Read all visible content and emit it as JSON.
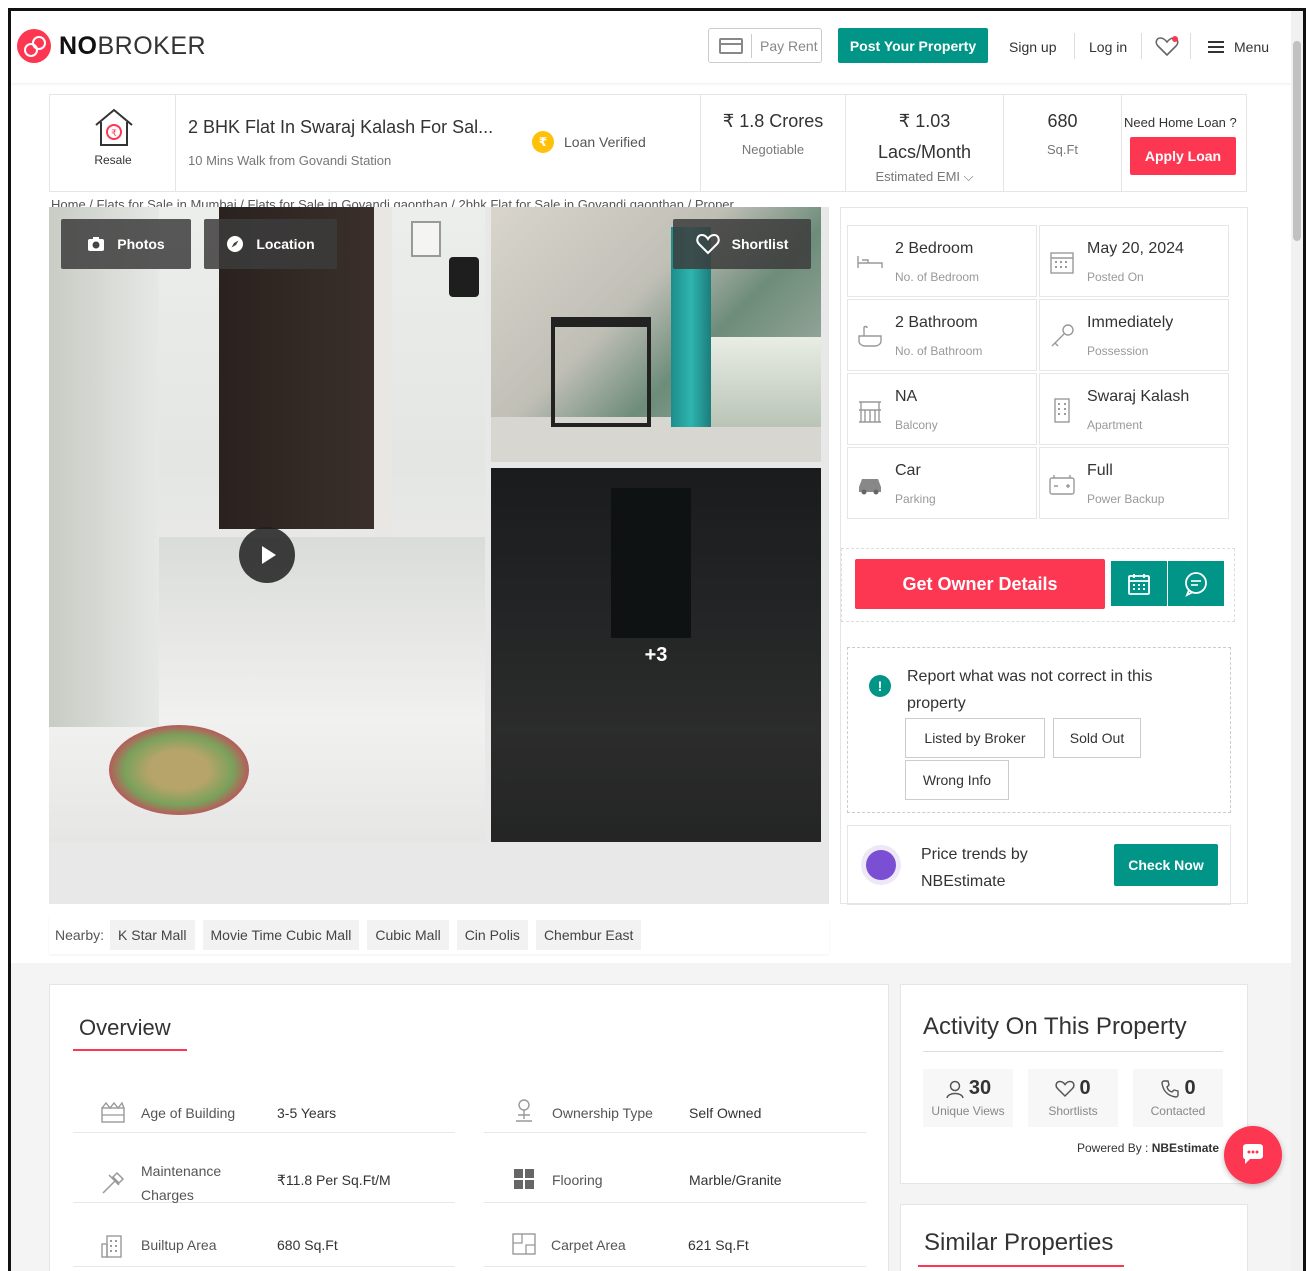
{
  "header": {
    "logo_text_bold": "NO",
    "logo_text_rest": "BROKER",
    "pay_rent": "Pay Rent",
    "post_property": "Post Your Property",
    "sign_up": "Sign up",
    "log_in": "Log in",
    "menu": "Menu"
  },
  "summary": {
    "resale": "Resale",
    "title": "2 BHK Flat In Swaraj Kalash For Sal...",
    "subtitle": "10 Mins Walk from Govandi Station",
    "loan_verified": "Loan Verified",
    "price": "₹ 1.8 Crores",
    "price_note": "Negotiable",
    "emi_line1": "₹ 1.03",
    "emi_line2": "Lacs/Month",
    "emi_note": "Estimated EMI",
    "area": "680",
    "area_unit": "Sq.Ft",
    "need_loan": "Need Home Loan ?",
    "apply_loan": "Apply Loan"
  },
  "breadcrumb": "Home / Flats for Sale in Mumbai / Flats for Sale in Govandi gaonthan / 2bhk Flat for Sale in Govandi gaonthan / Proper",
  "gallery": {
    "photos": "Photos",
    "location": "Location",
    "shortlist": "Shortlist",
    "more_count": "+3"
  },
  "details": [
    {
      "value": "2 Bedroom",
      "label": "No. of Bedroom",
      "icon": "bed-icon"
    },
    {
      "value": "May 20, 2024",
      "label": "Posted On",
      "icon": "calendar-icon"
    },
    {
      "value": "2 Bathroom",
      "label": "No. of Bathroom",
      "icon": "bathtub-icon"
    },
    {
      "value": "Immediately",
      "label": "Possession",
      "icon": "key-icon"
    },
    {
      "value": "NA",
      "label": "Balcony",
      "icon": "balcony-icon"
    },
    {
      "value": "Swaraj Kalash",
      "label": "Apartment",
      "icon": "building-icon"
    },
    {
      "value": "Car",
      "label": "Parking",
      "icon": "car-icon"
    },
    {
      "value": "Full",
      "label": "Power Backup",
      "icon": "battery-icon"
    }
  ],
  "owner": {
    "get_owner_details": "Get Owner Details"
  },
  "report": {
    "text": "Report what was not correct in this property",
    "listed_by_broker": "Listed by Broker",
    "sold_out": "Sold Out",
    "wrong_info": "Wrong Info"
  },
  "trends": {
    "line1": "Price trends by",
    "line2": "NBEstimate",
    "check_now": "Check Now"
  },
  "nearby": {
    "label": "Nearby:",
    "items": [
      "K Star Mall",
      "Movie Time Cubic Mall",
      "Cubic Mall",
      "Cin Polis",
      "Chembur East"
    ]
  },
  "overview": {
    "title": "Overview",
    "rows": [
      {
        "label": "Age of Building",
        "value": "3-5 Years"
      },
      {
        "label": "Ownership Type",
        "value": "Self Owned"
      },
      {
        "label": "Maintenance Charges",
        "value": "₹11.8 Per Sq.Ft/M"
      },
      {
        "label": "Flooring",
        "value": "Marble/Granite"
      },
      {
        "label": "Builtup Area",
        "value": "680 Sq.Ft"
      },
      {
        "label": "Carpet Area",
        "value": "621 Sq.Ft"
      }
    ],
    "maintenance_line1": "Maintenance",
    "maintenance_line2": "Charges"
  },
  "activity": {
    "title": "Activity On This Property",
    "unique_views": "30",
    "unique_views_label": "Unique Views",
    "shortlists": "0",
    "shortlists_label": "Shortlists",
    "contacted": "0",
    "contacted_label": "Contacted",
    "powered_by": "Powered By :",
    "powered_name": "NBEstimate"
  },
  "similar": {
    "title": "Similar Properties"
  },
  "colors": {
    "brand_red": "#fd3752",
    "brand_teal": "#009587"
  }
}
